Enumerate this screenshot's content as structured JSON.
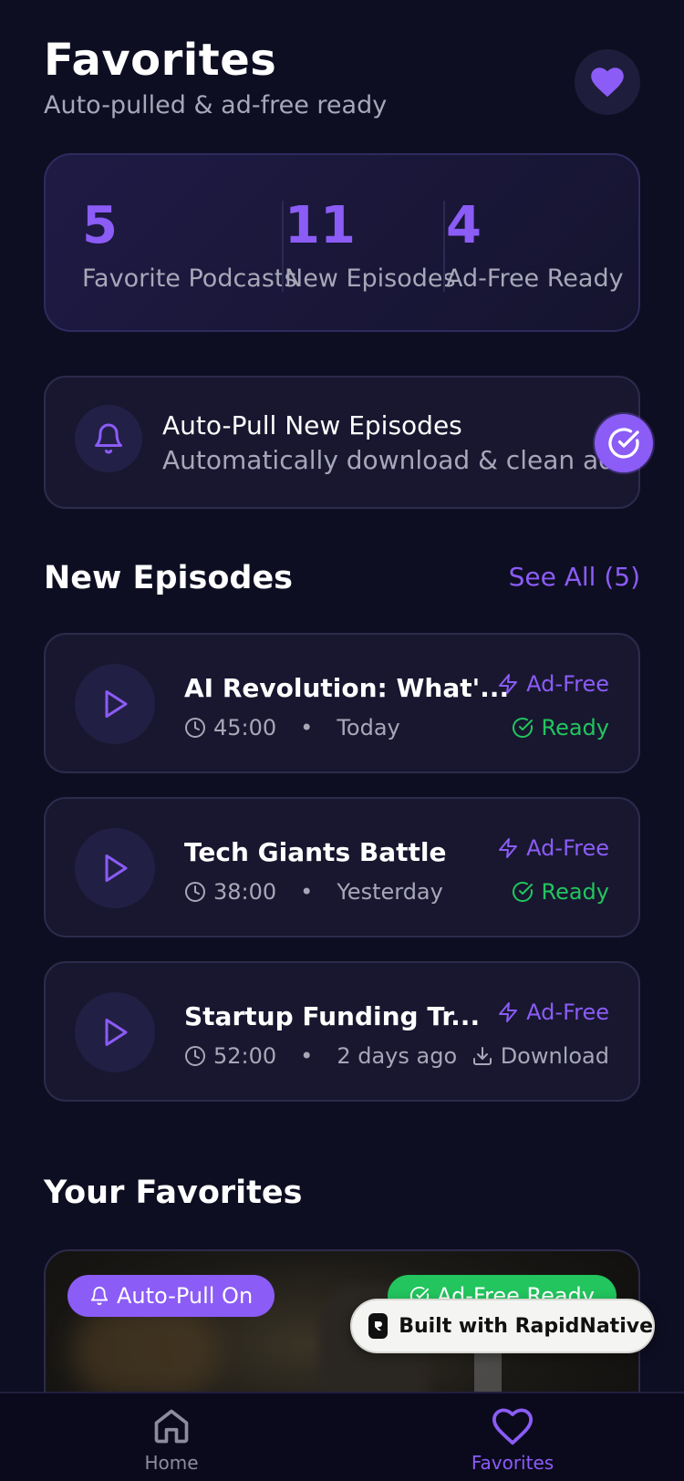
{
  "header": {
    "title": "Favorites",
    "subtitle": "Auto-pulled & ad-free ready",
    "icon": "heart-icon"
  },
  "stats": [
    {
      "value": "5",
      "label": "Favorite Podcasts"
    },
    {
      "value": "11",
      "label": "New Episodes"
    },
    {
      "value": "4",
      "label": "Ad-Free Ready"
    }
  ],
  "auto_pull": {
    "title": "Auto-Pull New Episodes",
    "subtitle": "Automatically download & clean ads",
    "enabled": true
  },
  "new_episodes": {
    "title": "New Episodes",
    "see_all": "See All (5)",
    "items": [
      {
        "title": "AI Revolution: What'...",
        "duration": "45:00",
        "date": "Today",
        "badge": "Ad-Free",
        "status": "Ready"
      },
      {
        "title": "Tech Giants Battle",
        "duration": "38:00",
        "date": "Yesterday",
        "badge": "Ad-Free",
        "status": "Ready"
      },
      {
        "title": "Startup Funding Tr...",
        "duration": "52:00",
        "date": "2 days ago",
        "badge": "Ad-Free",
        "status": "Download"
      }
    ]
  },
  "favorites": {
    "title": "Your Favorites",
    "pill_autopull": "Auto-Pull On",
    "pill_adfree": "Ad-Free Ready"
  },
  "badge": {
    "text": "Built with RapidNative"
  },
  "tabs": [
    {
      "label": "Home",
      "icon": "home-icon"
    },
    {
      "label": "Favorites",
      "icon": "heart-icon"
    }
  ],
  "colors": {
    "background": "#0e0e22",
    "accent": "#8b5cf6",
    "success": "#22c55e",
    "muted": "#a7a7b8"
  }
}
